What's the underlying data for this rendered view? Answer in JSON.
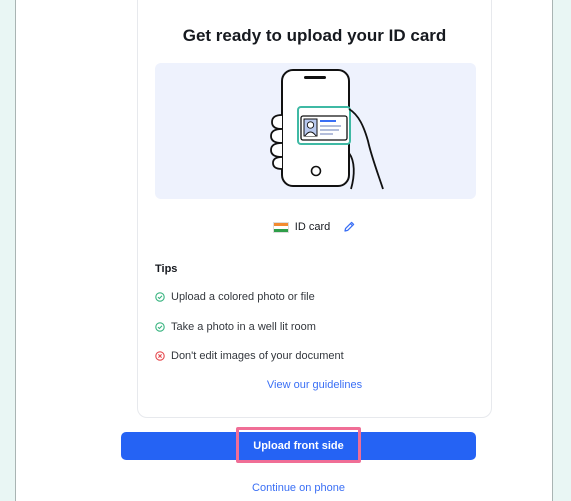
{
  "card": {
    "title": "Get ready to upload your ID card",
    "illustration_icon": "phone-with-id-card-illustration",
    "document": {
      "flag_icon": "india-flag-icon",
      "label": "ID card",
      "edit_icon": "pencil-icon"
    },
    "tips": {
      "heading": "Tips",
      "items": [
        {
          "text": "Upload a colored photo or file",
          "status": "ok",
          "icon": "check-circle-icon"
        },
        {
          "text": "Take a photo in a well lit room",
          "status": "ok",
          "icon": "check-circle-icon"
        },
        {
          "text": "Don't edit images of your document",
          "status": "bad",
          "icon": "x-circle-icon"
        }
      ]
    },
    "guidelines_link": "View our guidelines"
  },
  "actions": {
    "upload_label": "Upload front side",
    "phone_link": "Continue on phone"
  },
  "colors": {
    "primary": "#2563f4",
    "link": "#3a6ff5",
    "ok": "#36b37e",
    "bad": "#e5484d",
    "highlight": "#f06e96",
    "illustration_bg": "#eef2fd",
    "page_bg": "#e9f6f4"
  }
}
